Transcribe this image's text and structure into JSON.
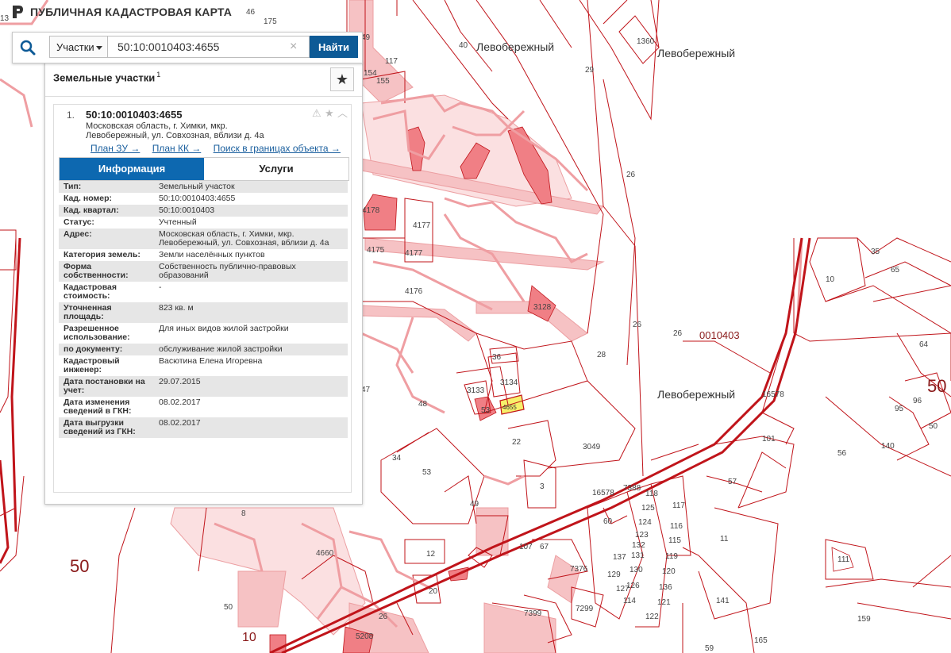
{
  "header": {
    "title": "ПУБЛИЧНАЯ КАДАСТРОВАЯ КАРТА",
    "logo_icon": "pkk-logo-icon"
  },
  "search": {
    "type_label": "Участки",
    "value": "50:10:0010403:4655",
    "clear_symbol": "×",
    "button_label": "Найти"
  },
  "panel": {
    "title": "Земельные участки",
    "count": "1",
    "favorite_symbol": "★",
    "result": {
      "number": "1.",
      "cad_number": "50:10:0010403:4655",
      "address_line1": "Московская область, г. Химки, мкр.",
      "address_line2": "Левобережный, ул. Совхозная, вблизи д. 4а",
      "icons": [
        "warning-icon",
        "star-icon",
        "collapse-icon"
      ],
      "links": [
        "План ЗУ →",
        "План КК →",
        "Поиск в границах объекта →"
      ],
      "tabs": [
        "Информация",
        "Услуги"
      ],
      "rows": [
        {
          "key": "Тип:",
          "value": "Земельный участок"
        },
        {
          "key": "Кад. номер:",
          "value": "50:10:0010403:4655",
          "link": true
        },
        {
          "key": "Кад. квартал:",
          "value": "50:10:0010403",
          "link": true
        },
        {
          "key": "Статус:",
          "value": "Учтенный"
        },
        {
          "key": "Адрес:",
          "value": "Московская область, г. Химки, мкр. Левобережный, ул. Совхозная, вблизи д. 4а"
        },
        {
          "key": "Категория земель:",
          "value": "Земли населённых пунктов"
        },
        {
          "key": "Форма собственности:",
          "value": "Собственность публично-правовых образований"
        },
        {
          "key": "Кадастровая стоимость:",
          "value": "-"
        },
        {
          "key": "Уточненная площадь:",
          "value": "823 кв. м"
        },
        {
          "key": "Разрешенное использование:",
          "value": "Для иных видов жилой застройки"
        },
        {
          "key": "по документу:",
          "value": "обслуживание жилой застройки"
        },
        {
          "key": "Кадастровый инженер:",
          "value": "Васютина Елена Игоревна"
        },
        {
          "key": "Дата постановки на учет:",
          "value": "29.07.2015"
        },
        {
          "key": "Дата изменения сведений в ГКН:",
          "value": "08.02.2017"
        },
        {
          "key": "Дата выгрузки сведений из ГКН:",
          "value": "08.02.2017"
        }
      ]
    }
  },
  "map": {
    "colors": {
      "parcel_line": "#c0141a",
      "building_fill": "#f07f85",
      "selected_fill": "#f7f06a",
      "road_fill": "#f6c2c4"
    },
    "labels": [
      {
        "id": "lbl-levoberezhny-1",
        "text": "Левобережный"
      },
      {
        "id": "lbl-levoberezhny-2",
        "text": "Левобережный"
      },
      {
        "id": "lbl-levoberezhny-3",
        "text": "Левобережный"
      },
      {
        "id": "lbl-quarter",
        "text": "0010403"
      },
      {
        "id": "lbl-50-left",
        "text": "50"
      },
      {
        "id": "lbl-50-right",
        "text": "50"
      },
      {
        "id": "lbl-10-bottom",
        "text": "10"
      },
      {
        "id": "lbl-selected",
        "text": "4655"
      },
      {
        "id": "p29",
        "text": "29"
      },
      {
        "id": "p26a",
        "text": "26"
      },
      {
        "id": "p26b",
        "text": "26"
      },
      {
        "id": "p26c",
        "text": "26"
      },
      {
        "id": "p28",
        "text": "28"
      },
      {
        "id": "p1360",
        "text": "1360"
      },
      {
        "id": "p40",
        "text": "40"
      },
      {
        "id": "p117",
        "text": "117"
      },
      {
        "id": "p154",
        "text": "154"
      },
      {
        "id": "p155",
        "text": "155"
      },
      {
        "id": "p4178",
        "text": "4178"
      },
      {
        "id": "p4177",
        "text": "4177"
      },
      {
        "id": "p4175",
        "text": "4175"
      },
      {
        "id": "p4177b",
        "text": "4177"
      },
      {
        "id": "p4176",
        "text": "4176"
      },
      {
        "id": "p3128",
        "text": "3128"
      },
      {
        "id": "p36",
        "text": "36"
      },
      {
        "id": "p3133",
        "text": "3133"
      },
      {
        "id": "p3134",
        "text": "3134"
      },
      {
        "id": "p48",
        "text": "48"
      },
      {
        "id": "p53s",
        "text": "53"
      },
      {
        "id": "p22",
        "text": "22"
      },
      {
        "id": "p3049",
        "text": "3049"
      },
      {
        "id": "p53",
        "text": "53"
      },
      {
        "id": "p49",
        "text": "49"
      },
      {
        "id": "p34",
        "text": "34"
      },
      {
        "id": "p3",
        "text": "3"
      },
      {
        "id": "p16578a",
        "text": "16578"
      },
      {
        "id": "p16578b",
        "text": "16578"
      },
      {
        "id": "p7388",
        "text": "7388"
      },
      {
        "id": "p60",
        "text": "60"
      },
      {
        "id": "p107",
        "text": "107"
      },
      {
        "id": "p67",
        "text": "67"
      },
      {
        "id": "p12",
        "text": "12"
      },
      {
        "id": "p20",
        "text": "20"
      },
      {
        "id": "p4660",
        "text": "4660"
      },
      {
        "id": "p8",
        "text": "8"
      },
      {
        "id": "p50s",
        "text": "50"
      },
      {
        "id": "p26d",
        "text": "26"
      },
      {
        "id": "p7376",
        "text": "7376"
      },
      {
        "id": "p7399",
        "text": "7399"
      },
      {
        "id": "p7299",
        "text": "7299"
      },
      {
        "id": "p10",
        "text": "10"
      },
      {
        "id": "p65",
        "text": "65"
      },
      {
        "id": "p35",
        "text": "35"
      },
      {
        "id": "p64",
        "text": "64"
      },
      {
        "id": "p96",
        "text": "96"
      },
      {
        "id": "p95",
        "text": "95"
      },
      {
        "id": "p140",
        "text": "140"
      },
      {
        "id": "p56",
        "text": "56"
      },
      {
        "id": "p101",
        "text": "101"
      },
      {
        "id": "p57",
        "text": "57"
      },
      {
        "id": "p11",
        "text": "11"
      },
      {
        "id": "p111",
        "text": "111"
      },
      {
        "id": "p141",
        "text": "141"
      },
      {
        "id": "p159",
        "text": "159"
      },
      {
        "id": "p165",
        "text": "165"
      },
      {
        "id": "p59",
        "text": "59"
      },
      {
        "id": "p118",
        "text": "118"
      },
      {
        "id": "p117b",
        "text": "117"
      },
      {
        "id": "p125",
        "text": "125"
      },
      {
        "id": "p124",
        "text": "124"
      },
      {
        "id": "p116",
        "text": "116"
      },
      {
        "id": "p123",
        "text": "123"
      },
      {
        "id": "p115",
        "text": "115"
      },
      {
        "id": "p132",
        "text": "132"
      },
      {
        "id": "p131",
        "text": "131"
      },
      {
        "id": "p119",
        "text": "119"
      },
      {
        "id": "p137",
        "text": "137"
      },
      {
        "id": "p130",
        "text": "130"
      },
      {
        "id": "p120",
        "text": "120"
      },
      {
        "id": "p129",
        "text": "129"
      },
      {
        "id": "p126",
        "text": "126"
      },
      {
        "id": "p136",
        "text": "136"
      },
      {
        "id": "p114",
        "text": "114"
      },
      {
        "id": "p127",
        "text": "127"
      },
      {
        "id": "p121",
        "text": "121"
      },
      {
        "id": "p122",
        "text": "122"
      },
      {
        "id": "p5208",
        "text": "5208"
      },
      {
        "id": "p13",
        "text": "13"
      },
      {
        "id": "p175",
        "text": "175"
      },
      {
        "id": "p46",
        "text": "46"
      },
      {
        "id": "p49s",
        "text": "49"
      },
      {
        "id": "p47",
        "text": "47"
      },
      {
        "id": "p50b",
        "text": "50"
      }
    ]
  }
}
